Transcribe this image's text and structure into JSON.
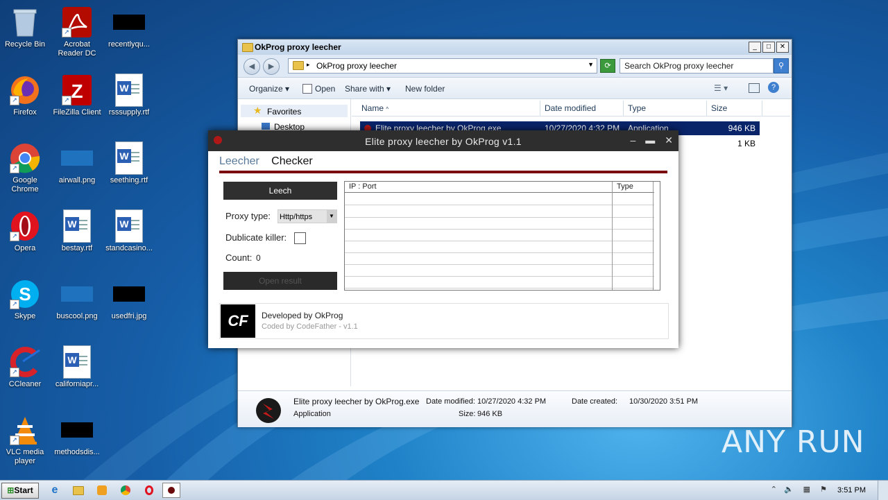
{
  "desktop": {
    "icons": [
      {
        "label": "Recycle Bin"
      },
      {
        "label": "Acrobat Reader DC"
      },
      {
        "label": "recentlyqu..."
      },
      {
        "label": "Firefox"
      },
      {
        "label": "FileZilla Client"
      },
      {
        "label": "rsssupply.rtf"
      },
      {
        "label": "Google Chrome"
      },
      {
        "label": "airwall.png"
      },
      {
        "label": "seething.rtf"
      },
      {
        "label": "Opera"
      },
      {
        "label": "bestay.rtf"
      },
      {
        "label": "standcasino..."
      },
      {
        "label": "Skype"
      },
      {
        "label": "buscool.png"
      },
      {
        "label": "usedfri.jpg"
      },
      {
        "label": "CCleaner"
      },
      {
        "label": "californiapr..."
      },
      {
        "label": "VLC media player"
      },
      {
        "label": "methodsdis..."
      }
    ],
    "watermark": "ANY  RUN"
  },
  "explorer": {
    "title": "OkProg proxy leecher",
    "address": "OkProg proxy leecher",
    "search_placeholder": "Search OkProg proxy leecher",
    "toolbar": {
      "organize": "Organize",
      "open": "Open",
      "share_with": "Share with",
      "new_folder": "New folder"
    },
    "nav": {
      "favorites": "Favorites",
      "desktop": "Desktop"
    },
    "columns": {
      "name": "Name",
      "date_modified": "Date modified",
      "type": "Type",
      "size": "Size"
    },
    "files": [
      {
        "name": "Elite proxy leecher by OkProg.exe",
        "date": "10/27/2020 4:32 PM",
        "type": "Application",
        "size": "946 KB"
      },
      {
        "size": "1 KB"
      }
    ],
    "details": {
      "filename": "Elite proxy leecher by OkProg.exe",
      "kind": "Application",
      "date_modified_label": "Date modified:",
      "date_modified": "10/27/2020 4:32 PM",
      "date_created_label": "Date created:",
      "date_created": "10/30/2020 3:51 PM",
      "size_label": "Size:",
      "size": "946 KB"
    }
  },
  "app": {
    "title": "Elite proxy leecher by OkProg v1.1",
    "tabs": {
      "leecher": "Leecher",
      "checker": "Checker"
    },
    "leech_button": "Leech",
    "proxy_type_label": "Proxy type:",
    "proxy_type_value": "Http/https",
    "dublicate_label": "Dublicate killer:",
    "count_label": "Count:",
    "count_value": "0",
    "open_result_button": "Open result",
    "grid_columns": {
      "ip_port": "IP : Port",
      "type": "Type"
    },
    "footer": {
      "logo": "CF",
      "developed": "Developed by OkProg",
      "coded": "Coded by CodeFather - v1.1"
    }
  },
  "taskbar": {
    "start": "Start",
    "clock": "3:51 PM"
  }
}
